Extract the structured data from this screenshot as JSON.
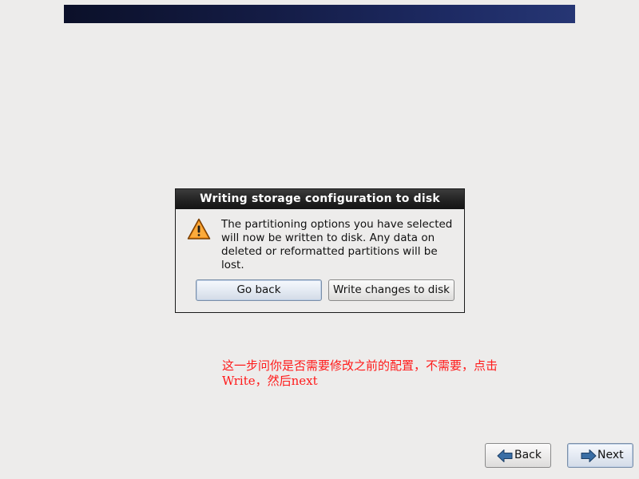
{
  "dialog": {
    "title": "Writing storage configuration to disk",
    "icon": "warning-icon",
    "message": "The partitioning options you have selected will now be written to disk.  Any data on deleted or reformatted partitions will be lost.",
    "buttons": {
      "go_back": "Go back",
      "write": "Write changes to disk"
    }
  },
  "annotation": {
    "line1": "这一步问你是否需要修改之前的配置，不需要，点击",
    "line2": "Write，然后next"
  },
  "navigation": {
    "back_label": "Back",
    "back_icon": "arrow-left-icon",
    "next_label": "Next",
    "next_icon": "arrow-right-icon"
  },
  "colors": {
    "banner": "#141c45",
    "annotation_text": "#ff1a1a",
    "warning_fill": "#f7941d",
    "arrow_fill": "#3a6ea5"
  }
}
